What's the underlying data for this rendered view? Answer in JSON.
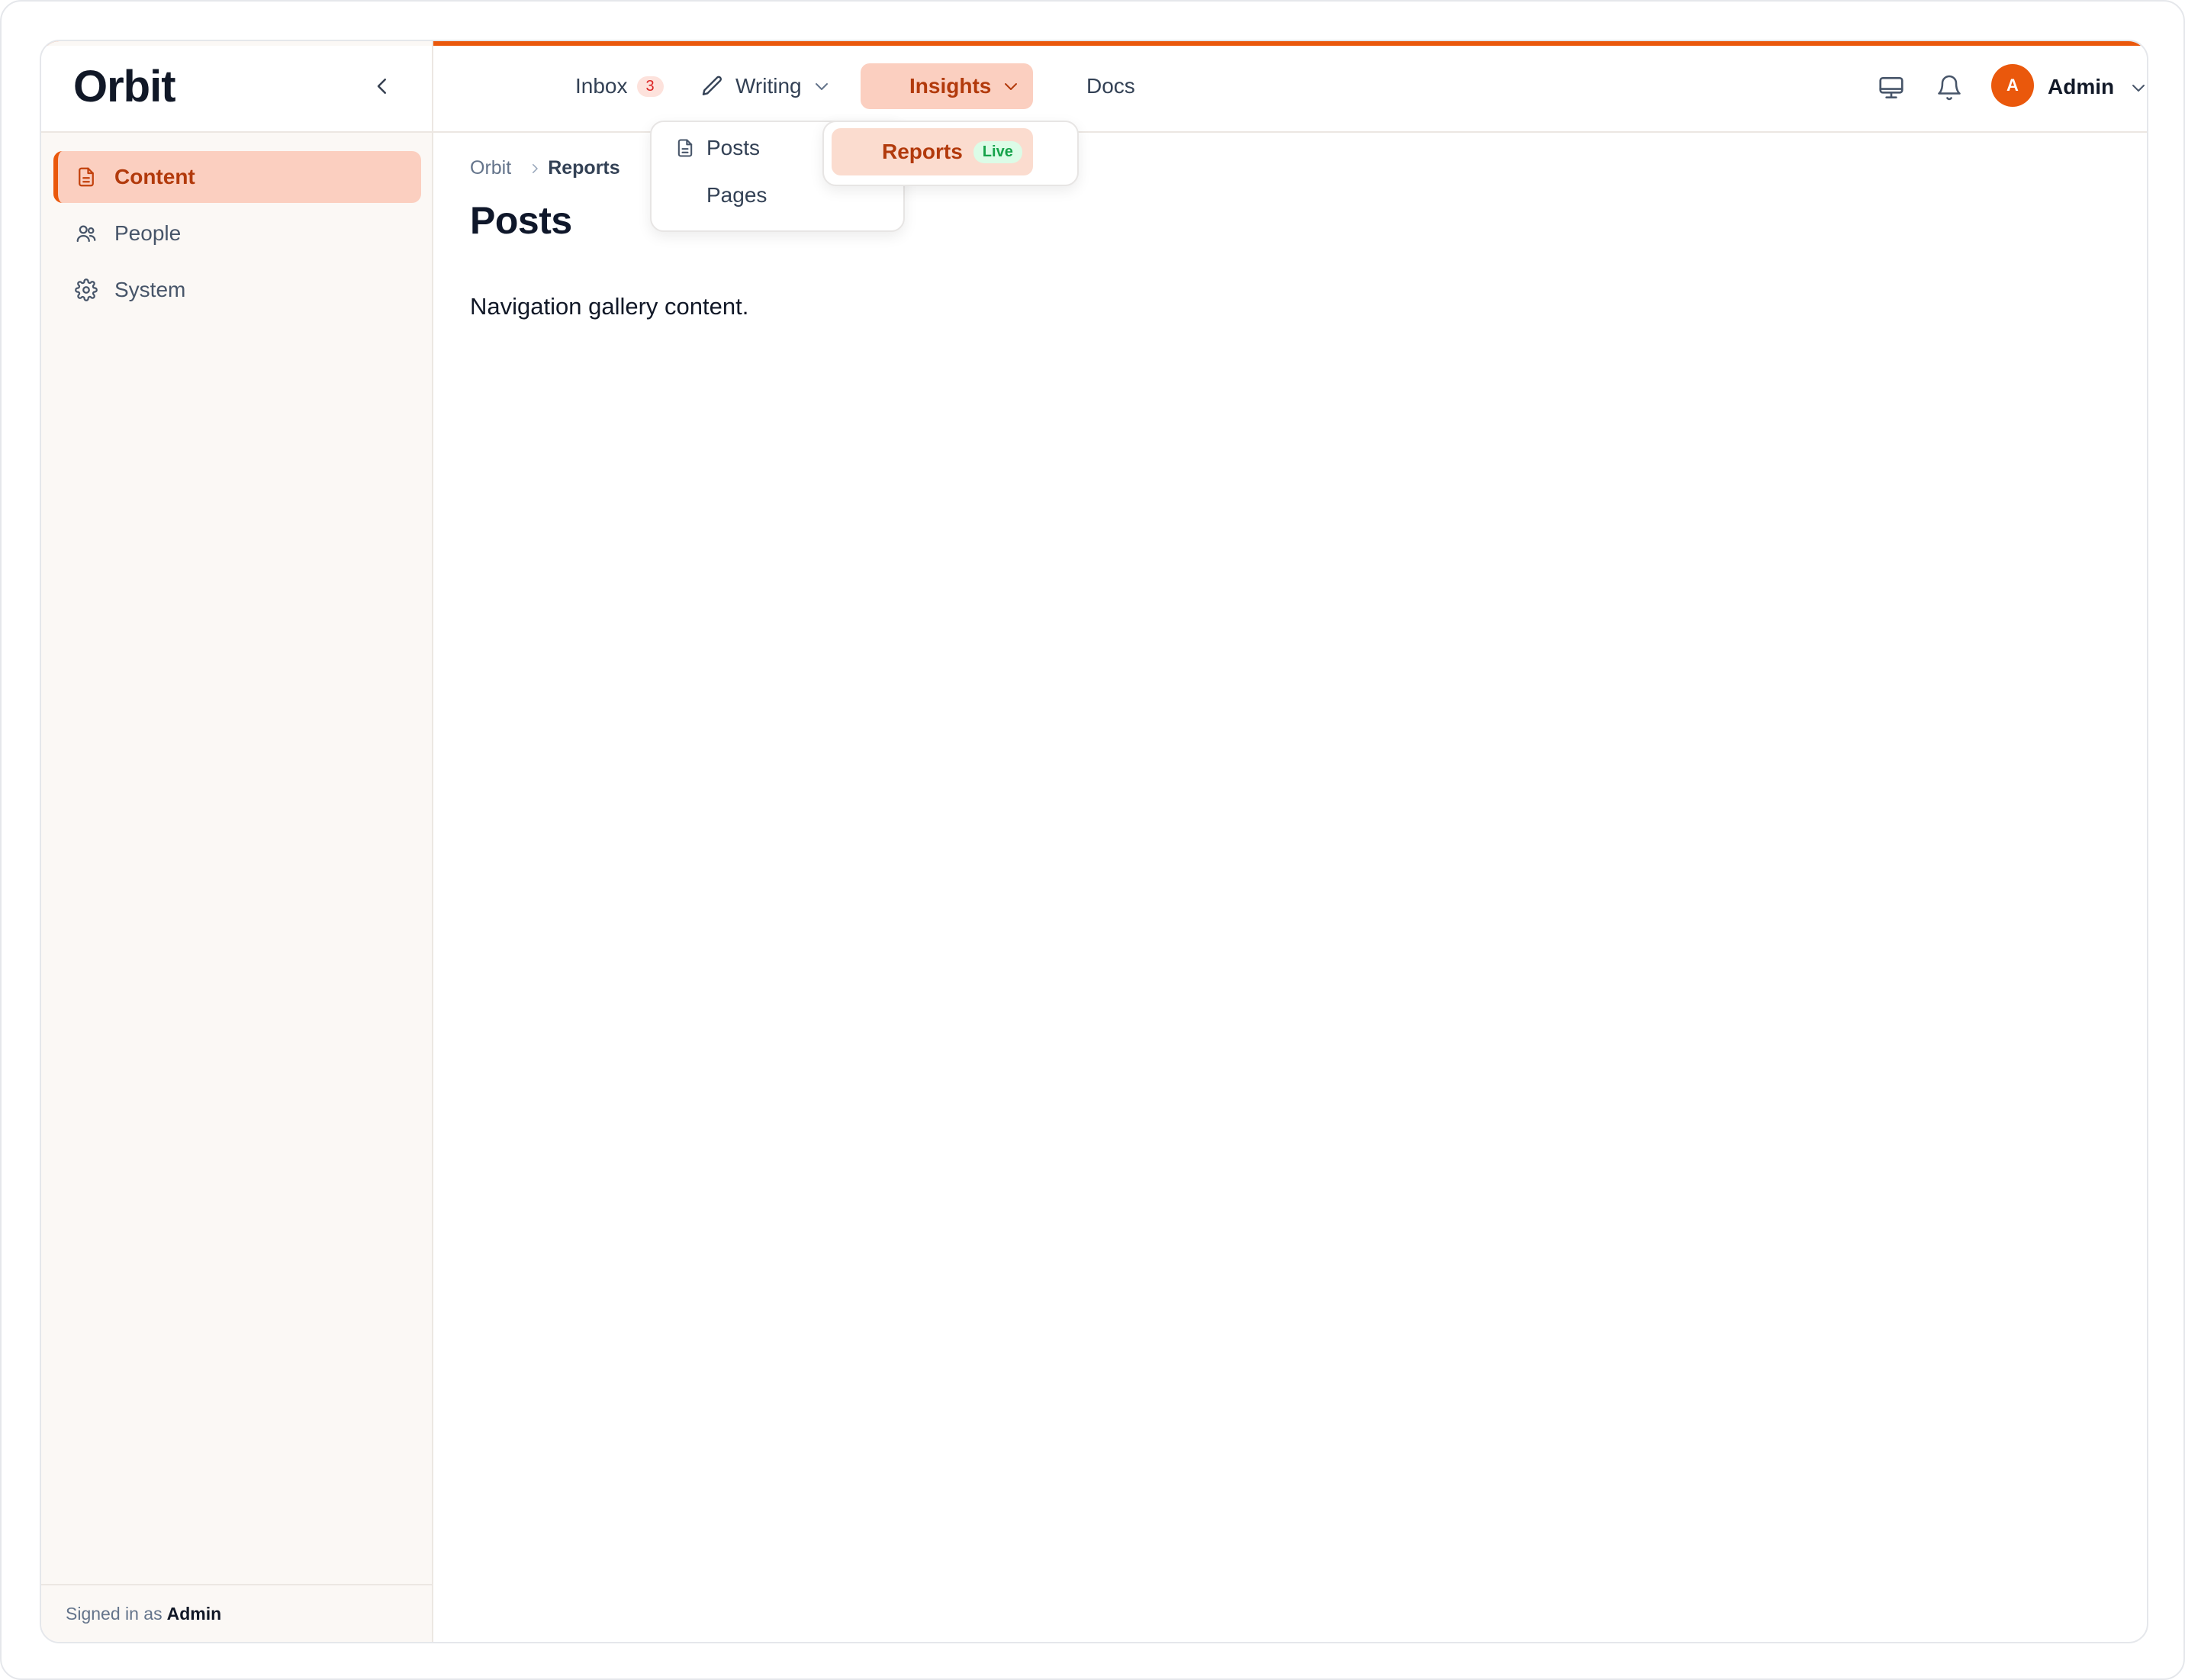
{
  "app": {
    "name": "Orbit"
  },
  "sidebar": {
    "items": [
      {
        "label": "Content",
        "icon": "document-icon",
        "active": true
      },
      {
        "label": "People",
        "icon": "people-icon",
        "active": false
      },
      {
        "label": "System",
        "icon": "gear-icon",
        "active": false
      }
    ],
    "footer": {
      "prefix": "Signed in as",
      "user": "Admin"
    }
  },
  "topnav": {
    "inbox": {
      "label": "Inbox",
      "count": "3"
    },
    "writing": {
      "label": "Writing"
    },
    "insights": {
      "label": "Insights",
      "active": true
    },
    "docs": {
      "label": "Docs"
    }
  },
  "writing_menu": {
    "items": [
      "Posts",
      "Pages"
    ]
  },
  "insights_menu": {
    "items": [
      {
        "label": "Reports",
        "badge": "Live",
        "active": true
      }
    ]
  },
  "user": {
    "initial": "A",
    "name": "Admin"
  },
  "breadcrumb": {
    "root": "Orbit",
    "current": "Reports"
  },
  "page": {
    "title": "Posts",
    "body": "Navigation gallery content."
  },
  "colors": {
    "accent": "#ea580c",
    "active_bg": "#fbcfc0",
    "active_text": "#b23a0c",
    "live": "#16a34a"
  }
}
